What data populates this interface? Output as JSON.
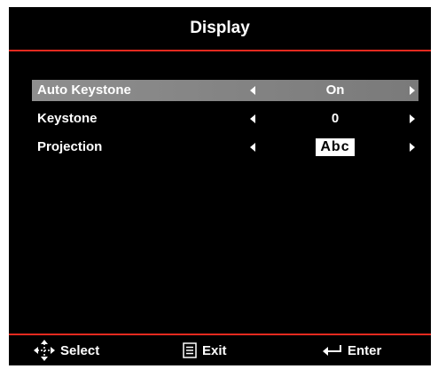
{
  "header": {
    "title": "Display"
  },
  "menu": {
    "items": [
      {
        "label": "Auto Keystone",
        "value": "On",
        "selected": true
      },
      {
        "label": "Keystone",
        "value": "0",
        "selected": false
      },
      {
        "label": "Projection",
        "value": "Abc",
        "selected": false
      }
    ]
  },
  "footer": {
    "select_label": "Select",
    "exit_label": "Exit",
    "enter_label": "Enter"
  },
  "colors": {
    "background": "#000000",
    "accent_rule": "#e52a1f",
    "selected_row": "#8e8e8e",
    "text": "#ffffff"
  },
  "icons": {
    "left": "arrow-left-icon",
    "right": "arrow-right-icon",
    "select": "dpad-move-icon",
    "exit": "menu-list-icon",
    "enter": "enter-return-icon"
  }
}
